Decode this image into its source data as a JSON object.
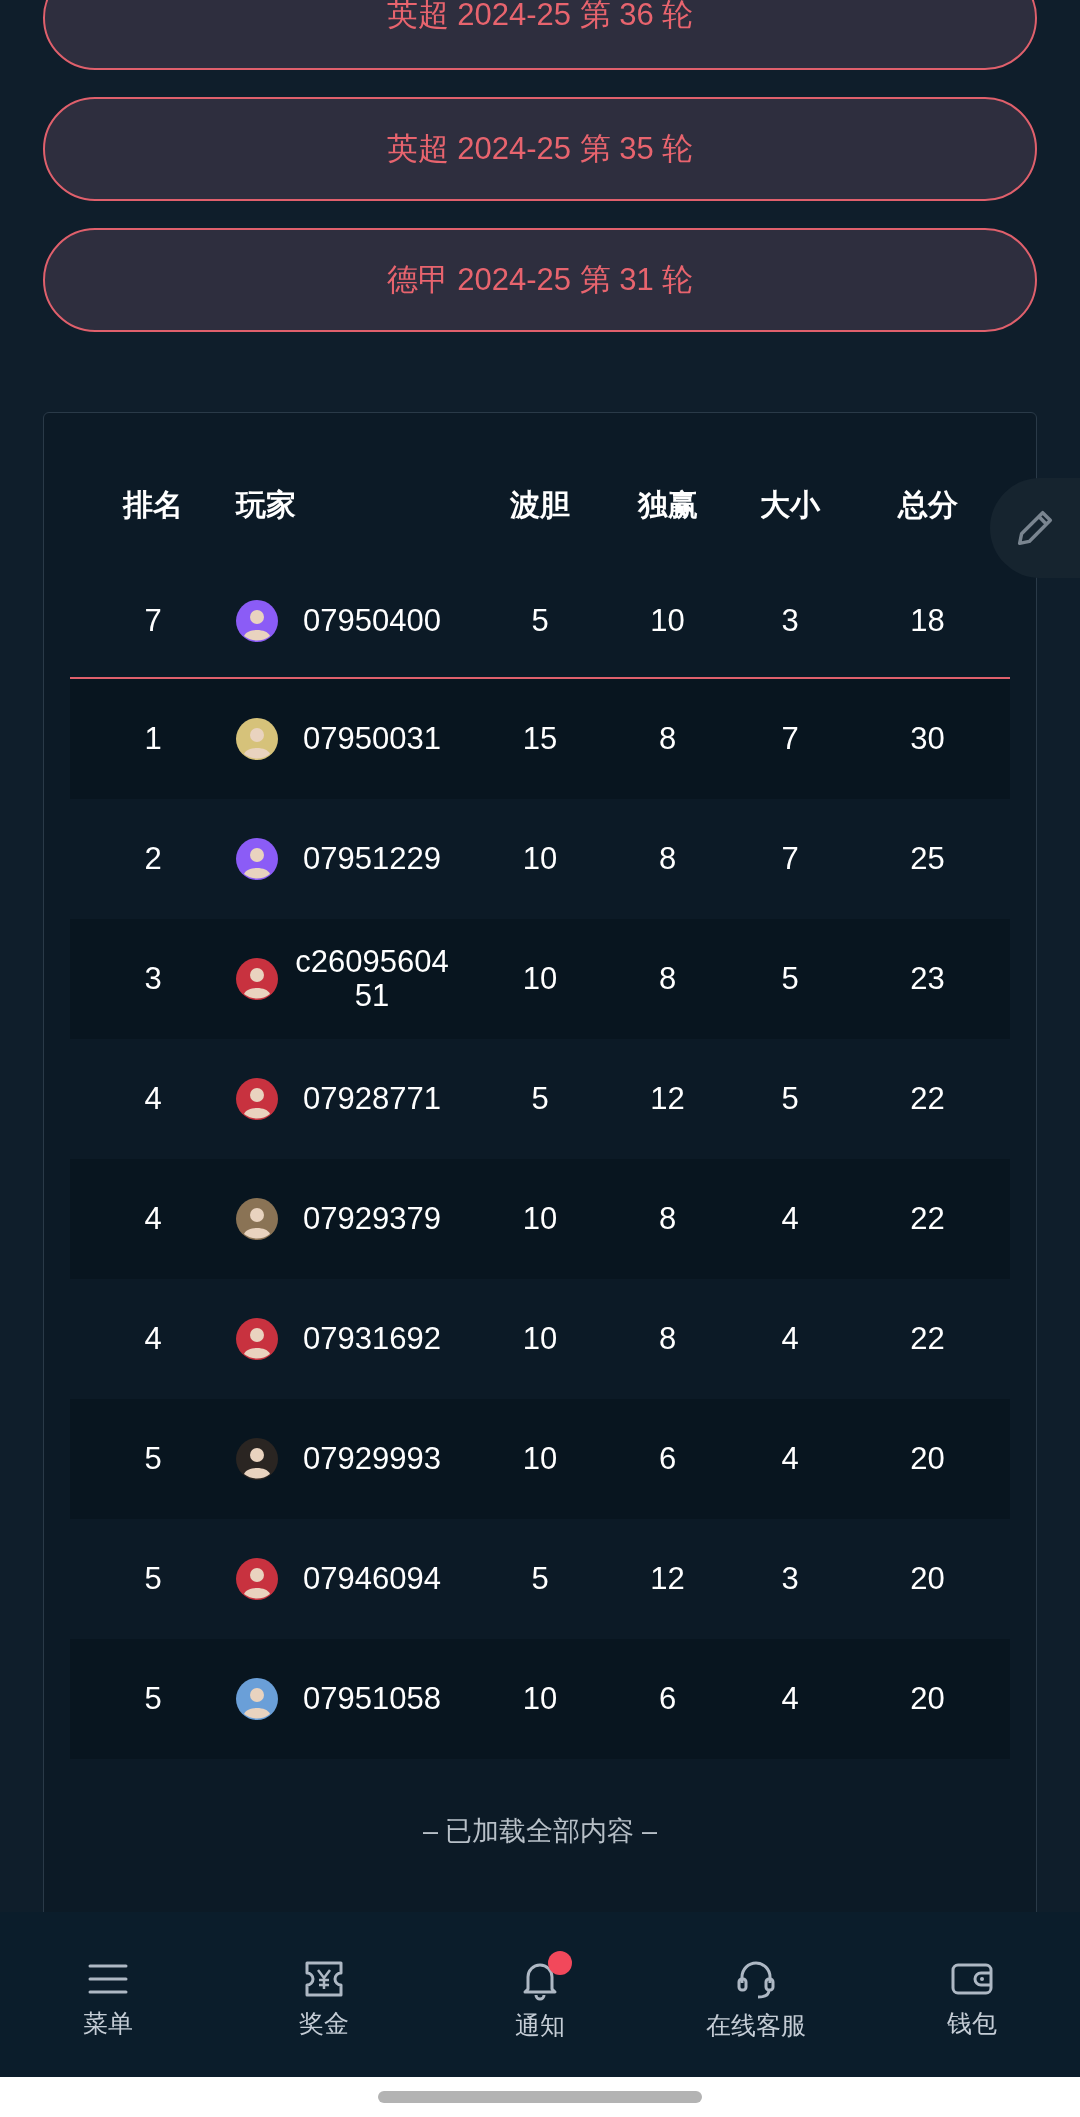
{
  "rounds": [
    {
      "label": "英超 2024-25 第 36 轮"
    },
    {
      "label": "英超 2024-25 第 35 轮"
    },
    {
      "label": "德甲 2024-25 第 31 轮"
    }
  ],
  "leaderboard": {
    "columns": [
      "排名",
      "玩家",
      "波胆",
      "独赢",
      "大小",
      "总分"
    ],
    "current_user": {
      "rank": "7",
      "player": "07950400",
      "color": "#8b5cf6",
      "bodan": "5",
      "duying": "10",
      "daxiao": "3",
      "total": "18"
    },
    "rows": [
      {
        "rank": "1",
        "player": "07950031",
        "color": "#d6c27a",
        "bodan": "15",
        "duying": "8",
        "daxiao": "7",
        "total": "30"
      },
      {
        "rank": "2",
        "player": "07951229",
        "color": "#8b5cf6",
        "bodan": "10",
        "duying": "8",
        "daxiao": "7",
        "total": "25"
      },
      {
        "rank": "3",
        "player": "c2609560451",
        "color": "#c8323f",
        "bodan": "10",
        "duying": "8",
        "daxiao": "5",
        "total": "23"
      },
      {
        "rank": "4",
        "player": "07928771",
        "color": "#c8323f",
        "bodan": "5",
        "duying": "12",
        "daxiao": "5",
        "total": "22"
      },
      {
        "rank": "4",
        "player": "07929379",
        "color": "#8a7355",
        "bodan": "10",
        "duying": "8",
        "daxiao": "4",
        "total": "22"
      },
      {
        "rank": "4",
        "player": "07931692",
        "color": "#c8323f",
        "bodan": "10",
        "duying": "8",
        "daxiao": "4",
        "total": "22"
      },
      {
        "rank": "5",
        "player": "07929993",
        "color": "#2a2522",
        "bodan": "10",
        "duying": "6",
        "daxiao": "4",
        "total": "20"
      },
      {
        "rank": "5",
        "player": "07946094",
        "color": "#c8323f",
        "bodan": "5",
        "duying": "12",
        "daxiao": "3",
        "total": "20"
      },
      {
        "rank": "5",
        "player": "07951058",
        "color": "#6a9fd8",
        "bodan": "10",
        "duying": "6",
        "daxiao": "4",
        "total": "20"
      }
    ],
    "footer": "– 已加载全部内容 –"
  },
  "bottom_nav": [
    {
      "label": "菜单",
      "badge": false
    },
    {
      "label": "奖金",
      "badge": false
    },
    {
      "label": "通知",
      "badge": true
    },
    {
      "label": "在线客服",
      "badge": false
    },
    {
      "label": "钱包",
      "badge": false
    }
  ]
}
